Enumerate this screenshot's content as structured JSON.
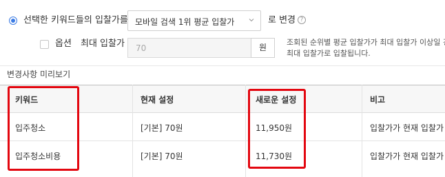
{
  "option_row": {
    "label": "선택한 키워드들의 입찰가를",
    "select_value": "모바일 검색 1위 평균 입찰가",
    "suffix": "로 변경",
    "help_glyph": "?"
  },
  "extra_row": {
    "option_label": "옵션",
    "max_bid_label": "최대 입찰가",
    "max_bid_value": "70",
    "unit": "원",
    "note_line1": "조회된 순위별 평균 입찰가가 최대 입찰가 이상일 경우",
    "note_line2": "최대 입찰가로 입찰됩니다."
  },
  "preview": {
    "title": "변경사항 미리보기",
    "columns": [
      "키워드",
      "현재 설정",
      "새로운 설정",
      "비고"
    ],
    "rows": [
      {
        "keyword": "입주청소",
        "current": "[기본] 70원",
        "new": "11,950원",
        "note": "입찰가가 현재 입찰가"
      },
      {
        "keyword": "입주청소비용",
        "current": "[기본] 70원",
        "new": "11,730원",
        "note": "입찰가가 현재 입찰가"
      }
    ]
  },
  "colors": {
    "accent": "#3b7be4",
    "highlight": "#e3060f",
    "header_bg": "#f7f7f7"
  }
}
